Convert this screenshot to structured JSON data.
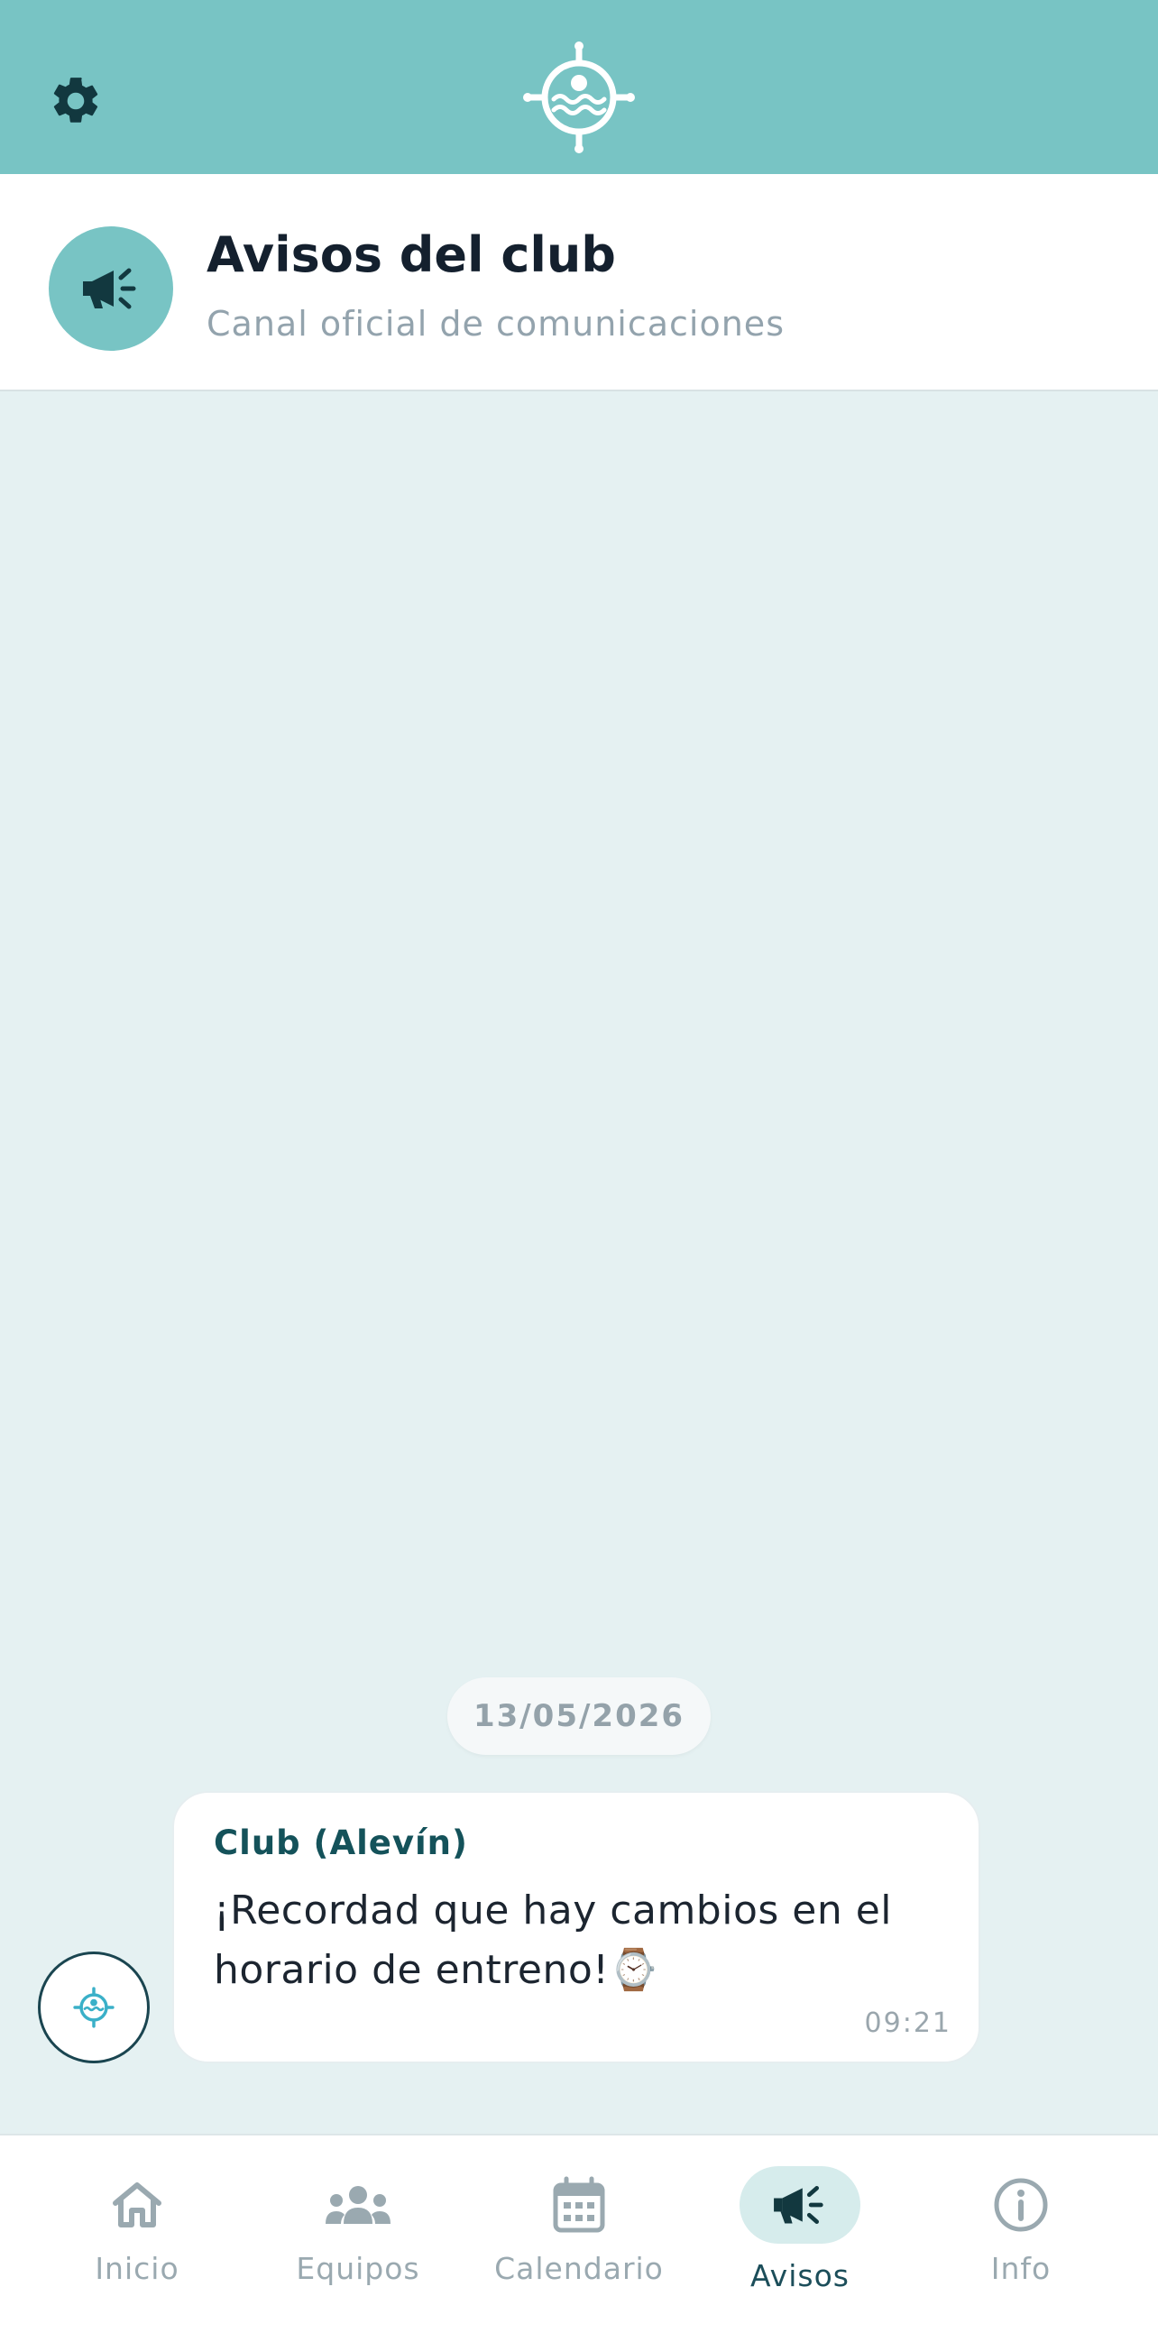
{
  "topbar": {
    "settings_icon": "gear-icon",
    "logo_icon": "club-wheel-logo-icon",
    "bg_color": "#78c4c4"
  },
  "channel": {
    "title": "Avisos del club",
    "subtitle": "Canal oficial de comunicaciones",
    "avatar_icon": "megaphone-icon"
  },
  "feed": {
    "date_separator": "13/05/2026",
    "messages": [
      {
        "sender": "Club (Alevín)",
        "text": "¡Recordad que hay cambios en el horario de entreno!⌚",
        "time": "09:21"
      }
    ]
  },
  "fab": {
    "icon": "club-logo-icon"
  },
  "bottom_nav": {
    "items": [
      {
        "label": "Inicio",
        "icon": "home-icon",
        "active": false
      },
      {
        "label": "Equipos",
        "icon": "people-icon",
        "active": false
      },
      {
        "label": "Calendario",
        "icon": "calendar-icon",
        "active": false
      },
      {
        "label": "Avisos",
        "icon": "megaphone-icon",
        "active": true
      },
      {
        "label": "Info",
        "icon": "info-icon",
        "active": false
      }
    ]
  },
  "colors": {
    "accent": "#78c4c4",
    "dark_accent": "#14525a",
    "feed_bg": "#e5f1f2"
  }
}
